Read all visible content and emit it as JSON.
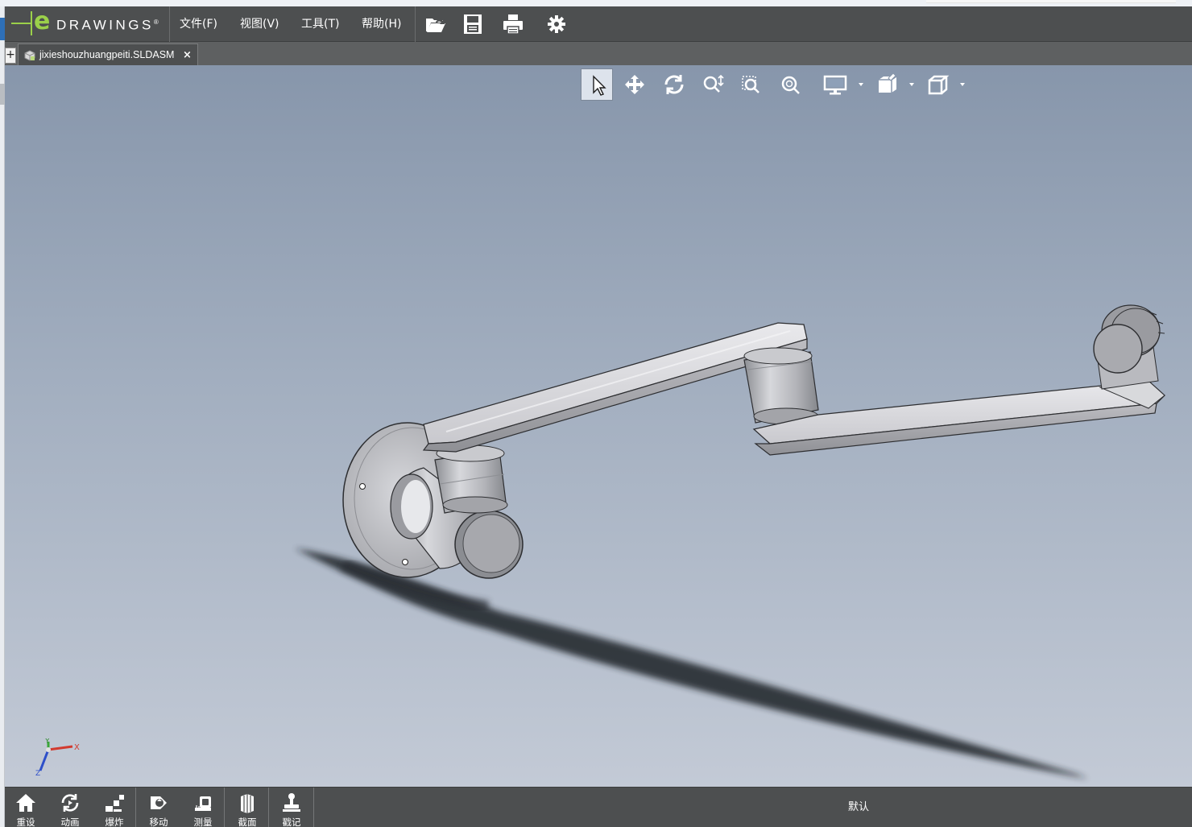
{
  "app": {
    "logo_letter": "e",
    "logo_word": "DRAWINGS",
    "logo_mark": "®"
  },
  "menu": [
    {
      "label": "文件(F)"
    },
    {
      "label": "视图(V)"
    },
    {
      "label": "工具(T)"
    },
    {
      "label": "帮助(H)"
    }
  ],
  "toolbar_icons": [
    "open-folder-icon",
    "save-icon",
    "print-icon",
    "settings-gear-icon"
  ],
  "tabs": {
    "add_label": "+",
    "document": {
      "name": "jixieshouzhuangpeiti.SLDASM",
      "close": "×"
    }
  },
  "view_toolbar": {
    "tools": [
      "select-arrow",
      "pan",
      "rotate",
      "zoom-in-out",
      "zoom-to-area",
      "zoom-to-fit",
      "display-style",
      "hide-show",
      "view-orientation"
    ],
    "active_tool": "select-arrow"
  },
  "triad": {
    "x_label": "X",
    "y_label": "Y",
    "z_label": "Z"
  },
  "bottom_tools": [
    {
      "label": "重设",
      "icon": "home-icon"
    },
    {
      "label": "动画",
      "icon": "animate-icon"
    },
    {
      "label": "爆炸",
      "icon": "explode-icon"
    },
    {
      "label": "移动",
      "icon": "move-component-icon"
    },
    {
      "label": "测量",
      "icon": "measure-icon"
    },
    {
      "label": "截面",
      "icon": "section-icon"
    },
    {
      "label": "戳记",
      "icon": "stamp-icon"
    }
  ],
  "configuration": {
    "label": "默认"
  },
  "colors": {
    "menu_bar": "#4d4f50",
    "logo_green": "#9bd04a",
    "viewport_top": "#8796ab",
    "viewport_bottom": "#c3cad6"
  }
}
